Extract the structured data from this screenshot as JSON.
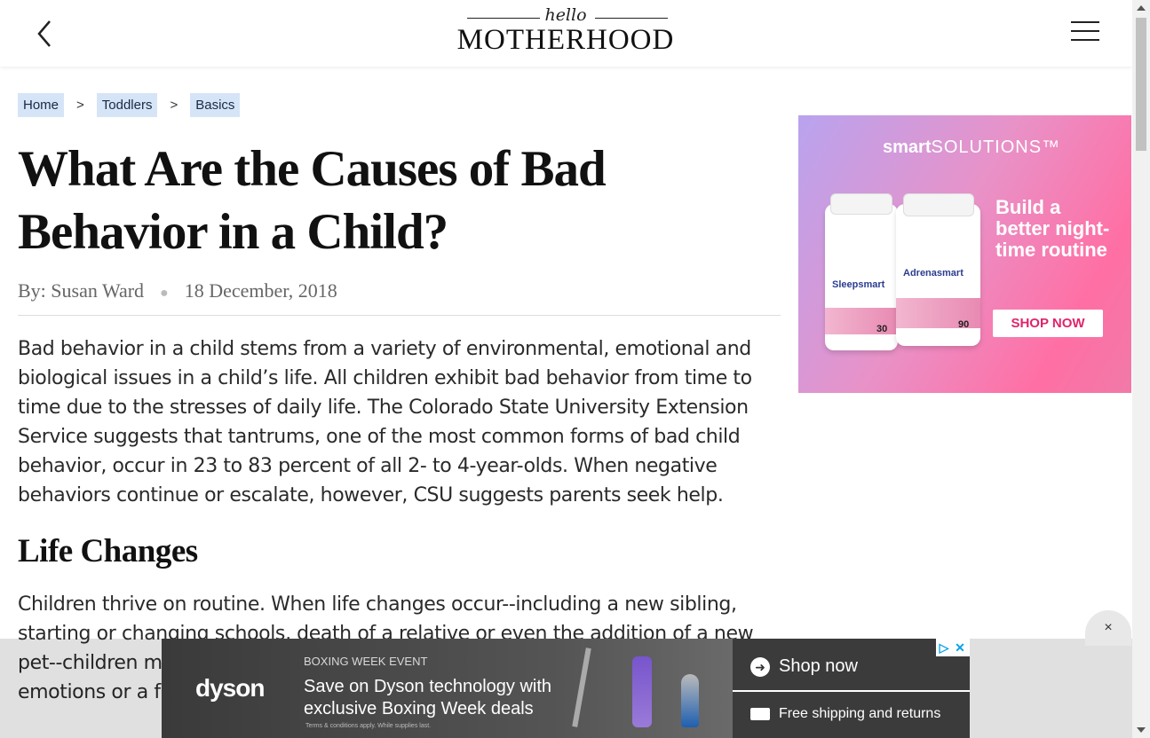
{
  "header": {
    "logo_small": "hello",
    "logo_big": "MOTHERHOOD"
  },
  "breadcrumb": [
    {
      "label": "Home"
    },
    {
      "label": "Toddlers"
    },
    {
      "label": "Basics"
    }
  ],
  "breadcrumb_sep": ">",
  "article": {
    "title": "What Are the Causes of Bad Behavior in a Child?",
    "author": "By: Susan Ward",
    "date": "18 December, 2018",
    "intro": "Bad behavior in a child stems from a variety of environmental, emotional and biological issues in a child’s life. All children exhibit bad behavior from time to time due to the stresses of daily life. The Colorado State University Extension Service suggests that tantrums, one of the most common forms of bad child behavior, occur in 23 to 83 percent of all 2- to 4-year-olds. When negative behaviors continue or escalate, however, CSU suggests parents seek help.",
    "section_heading": "Life Changes",
    "section_text": "Children thrive on routine. When life changes occur--including a new sibling, starting or changing schools, death of a relative or even the addition of a new pet--children may exhibit bad behavior as they work through their new emotions or a fear of the unknown. A child may be"
  },
  "side_ad": {
    "brand_bold": "smart",
    "brand_light": "SOLUTIONS™",
    "headline": "Build a better night-time routine",
    "cta": "SHOP NOW",
    "bottle1_label": "Sleepsmart",
    "bottle2_label": "Adrenasmart",
    "bottle1_count": "30",
    "bottle2_count": "90"
  },
  "bottom_ad": {
    "brand": "dyson",
    "event": "BOXING WEEK EVENT",
    "message": "Save on Dyson technology with exclusive Boxing Week deals",
    "terms": "Terms & conditions apply. While supplies last.",
    "shop_now": "Shop now",
    "free_shipping": "Free shipping and returns"
  },
  "close_label": "×",
  "colors": {
    "crumb_bg": "#d6e4f7",
    "ad_pink": "#ff6fa4",
    "ad_cta_text": "#e0246a"
  }
}
